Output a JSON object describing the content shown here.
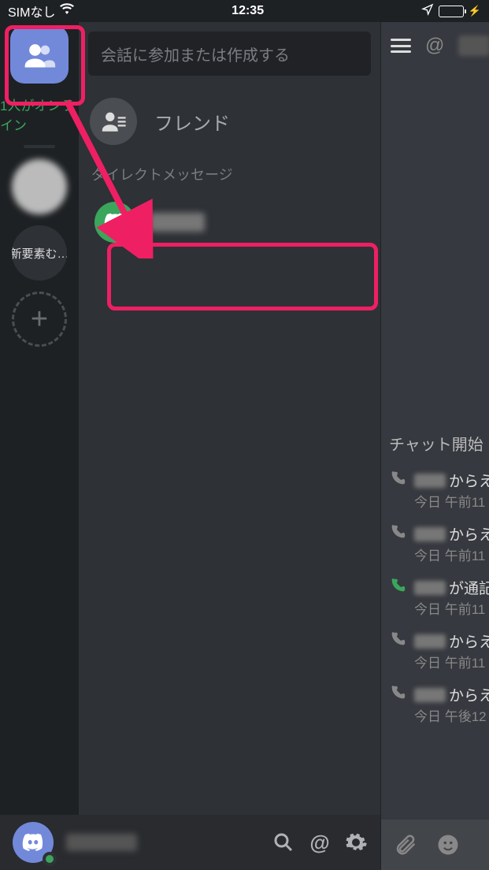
{
  "status": {
    "carrier": "SIMなし",
    "time": "12:35"
  },
  "rail": {
    "online_text": "1人がオンライン",
    "server_text_label": "新要素む…"
  },
  "dm": {
    "search_placeholder": "会話に参加または作成する",
    "friends_label": "フレンド",
    "section_label": "ダイレクトメッセージ"
  },
  "chat": {
    "at": "@",
    "section_title": "チャット開始",
    "calls": [
      {
        "suffix": "からえ",
        "time": "今日 午前11",
        "color": "#888"
      },
      {
        "suffix": "からえ",
        "time": "今日 午前11",
        "color": "#888"
      },
      {
        "suffix": "が通記",
        "time": "今日 午前11",
        "color": "#3ba55c"
      },
      {
        "suffix": "からえ",
        "time": "今日 午前11",
        "color": "#888"
      },
      {
        "suffix": "からえ",
        "time": "今日 午後12",
        "color": "#888"
      }
    ]
  }
}
